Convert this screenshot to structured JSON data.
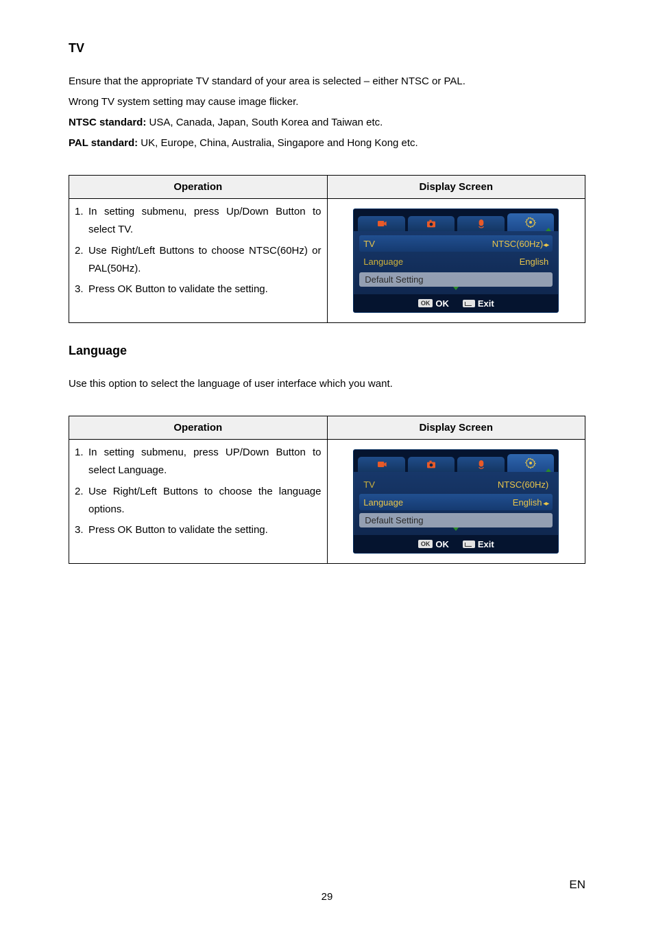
{
  "section1": {
    "title": "TV",
    "para1": "Ensure that the appropriate TV standard of your area is selected – either NTSC or PAL.",
    "para2": "Wrong TV system setting may cause image flicker.",
    "ntsc_bold": "NTSC standard:",
    "ntsc_text": " USA, Canada, Japan, South Korea and Taiwan etc.",
    "pal_bold": "PAL standard:",
    "pal_text": " UK, Europe, China, Australia, Singapore and Hong Kong etc."
  },
  "tableHeaders": {
    "operation": "Operation",
    "display": "Display Screen"
  },
  "table1": {
    "steps": [
      {
        "n": "1.",
        "t": "In setting submenu, press Up/Down Button to select TV."
      },
      {
        "n": "2.",
        "t": "Use Right/Left Buttons to choose NTSC(60Hz) or PAL(50Hz)."
      },
      {
        "n": "3.",
        "t": "Press OK Button to validate the setting."
      }
    ],
    "screen": {
      "tv_label": "TV",
      "tv_value": "NTSC(60Hz)",
      "lang_label": "Language",
      "lang_value": "English",
      "default_label": "Default Setting",
      "ok": "OK",
      "exit": "Exit",
      "ok_badge": "OK",
      "highlight_row": "tv"
    }
  },
  "section2": {
    "title": "Language",
    "para": "Use this option to select the language of user interface which you want."
  },
  "table2": {
    "steps": [
      {
        "n": "1.",
        "t": "In setting submenu, press UP/Down Button to select Language."
      },
      {
        "n": "2.",
        "t": "Use Right/Left Buttons to choose the language options."
      },
      {
        "n": "3.",
        "t": "Press OK Button to validate the setting."
      }
    ],
    "screen": {
      "tv_label": "TV",
      "tv_value": "NTSC(60Hz)",
      "lang_label": "Language",
      "lang_value": "English",
      "default_label": "Default Setting",
      "ok": "OK",
      "exit": "Exit",
      "ok_badge": "OK",
      "highlight_row": "lang"
    }
  },
  "pageNumber": "29",
  "langCorner": "EN"
}
